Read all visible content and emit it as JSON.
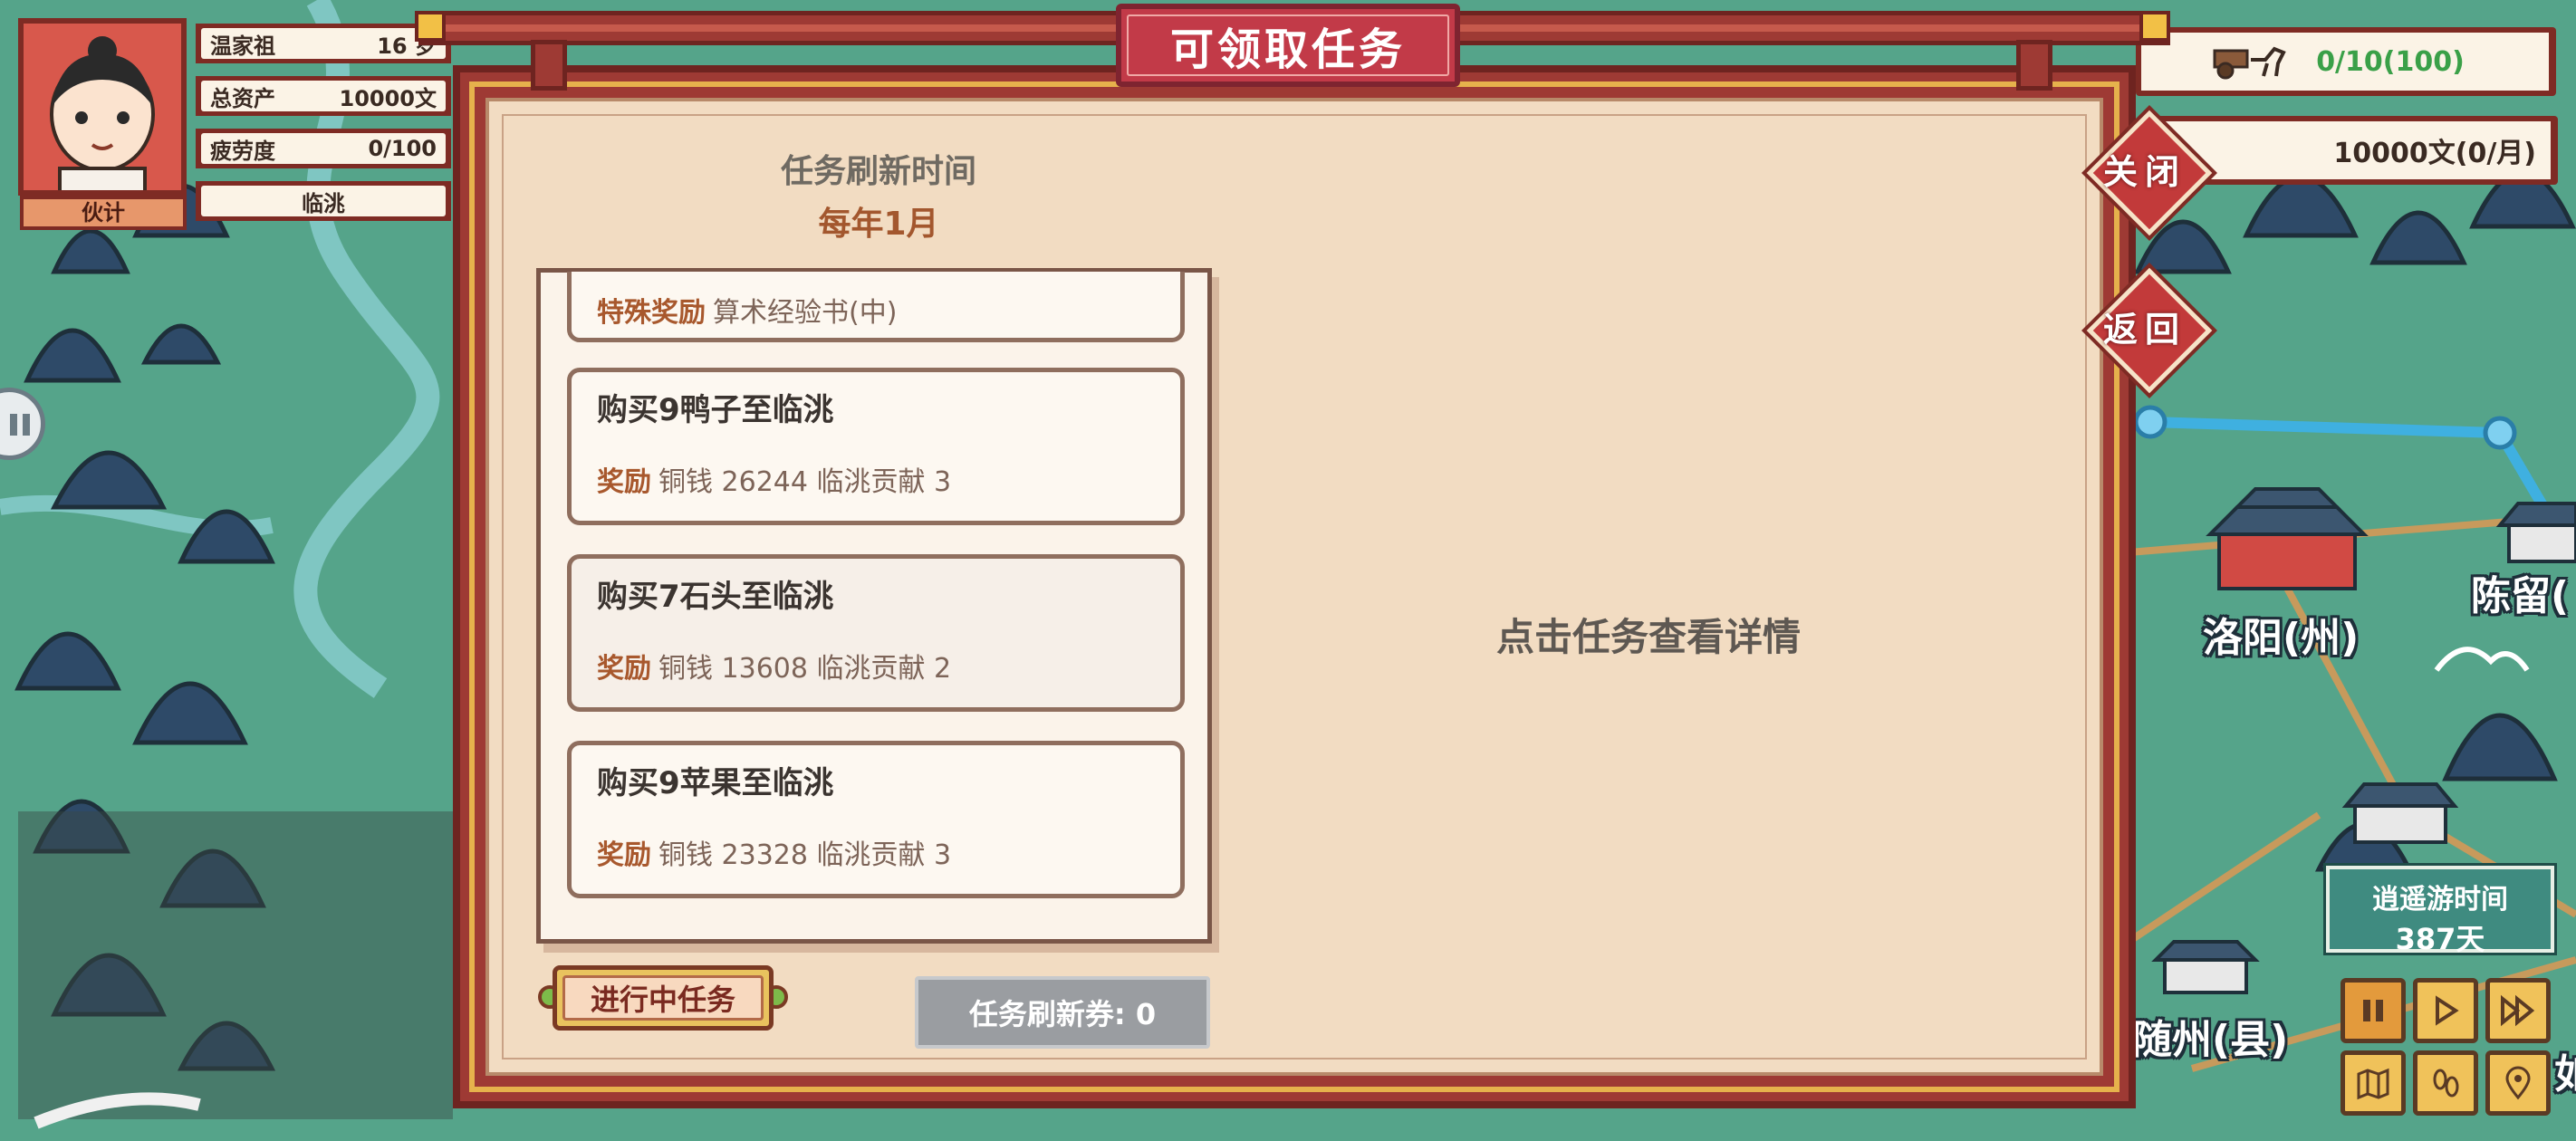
{
  "player": {
    "name": "温家祖",
    "age": "16 岁",
    "assets_label": "总资产",
    "assets_value": "10000文",
    "fatigue_label": "疲劳度",
    "fatigue_value": "0/100",
    "role": "伙计",
    "location": "临洮"
  },
  "resources": {
    "caravan": "0/10(100)",
    "money": "10000文(0/月)"
  },
  "buttons": {
    "close": "关闭",
    "back": "返回"
  },
  "dialog": {
    "title": "可领取任务",
    "refresh_label": "任务刷新时间",
    "refresh_value": "每年1月",
    "detail_hint": "点击任务查看详情",
    "ongoing_button": "进行中任务",
    "refresh_ticket": "任务刷新券: 0",
    "tasks": [
      {
        "title": "",
        "reward_label": "特殊奖励",
        "reward": "算术经验书(中)"
      },
      {
        "title": "购买9鸭子至临洮",
        "reward_label": "奖励",
        "reward": "铜钱 26244 临洮贡献 3"
      },
      {
        "title": "购买7石头至临洮",
        "reward_label": "奖励",
        "reward": "铜钱 13608 临洮贡献 2"
      },
      {
        "title": "购买9苹果至临洮",
        "reward_label": "奖励",
        "reward": "铜钱 23328 临洮贡献 3"
      }
    ]
  },
  "map": {
    "cities": [
      "洛阳(州)",
      "陈留(",
      "随州(县)",
      "如"
    ]
  },
  "time": {
    "label": "逍遥游时间",
    "days": "387天"
  },
  "colors": {
    "dialog_red": "#9e3a34",
    "paper": "#f2dcc2",
    "reward_label": "#a8582d",
    "map_green": "#4a9a86"
  }
}
